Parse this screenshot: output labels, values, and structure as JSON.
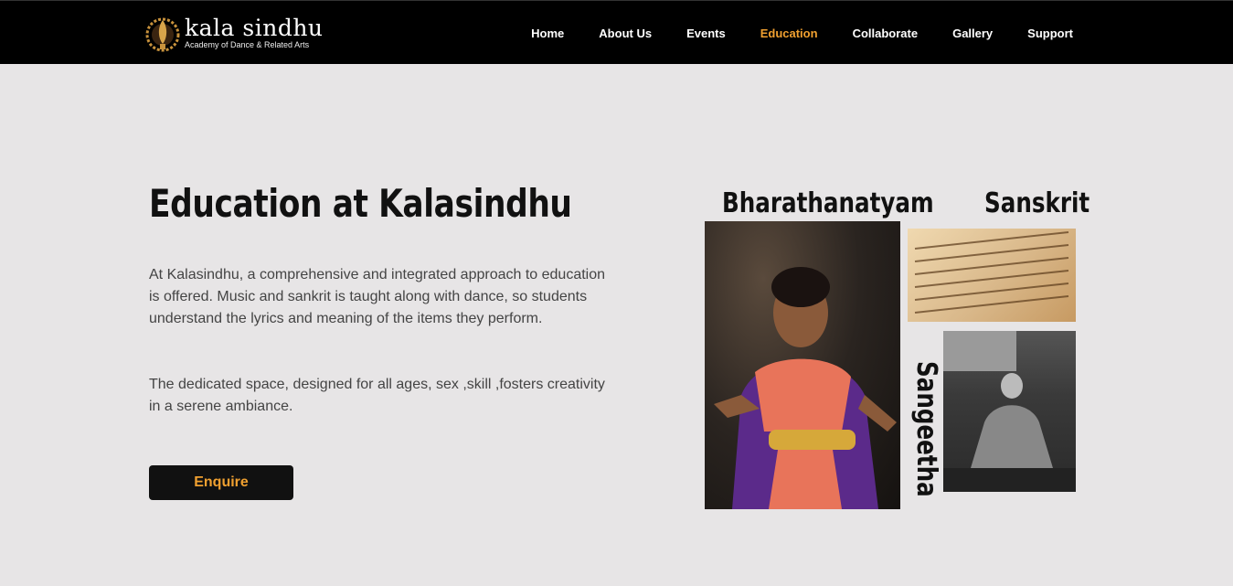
{
  "brand": {
    "name": "kala sindhu",
    "tagline": "Academy of Dance & Related Arts"
  },
  "nav": {
    "items": [
      {
        "label": "Home"
      },
      {
        "label": "About Us"
      },
      {
        "label": "Events"
      },
      {
        "label": "Education",
        "active": true
      },
      {
        "label": "Collaborate"
      },
      {
        "label": "Gallery"
      },
      {
        "label": "Support"
      }
    ]
  },
  "hero": {
    "title": "Education at Kalasindhu",
    "paragraph1": "At Kalasindhu, a comprehensive and integrated approach to education is offered. Music and sankrit is taught along with dance, so students understand the lyrics and meaning of the items they perform.",
    "paragraph2": "The dedicated space, designed for all ages, sex ,skill ,fosters creativity in a serene ambiance.",
    "button_label": "Enquire"
  },
  "gallery": {
    "bharathanatyam_label": "Bharathanatyam",
    "sanskrit_label": "Sanskrit",
    "sangeetha_label": "Sangeetha"
  },
  "colors": {
    "accent": "#f0a030",
    "nav_bg": "#000000",
    "page_bg": "#e7e5e6"
  }
}
